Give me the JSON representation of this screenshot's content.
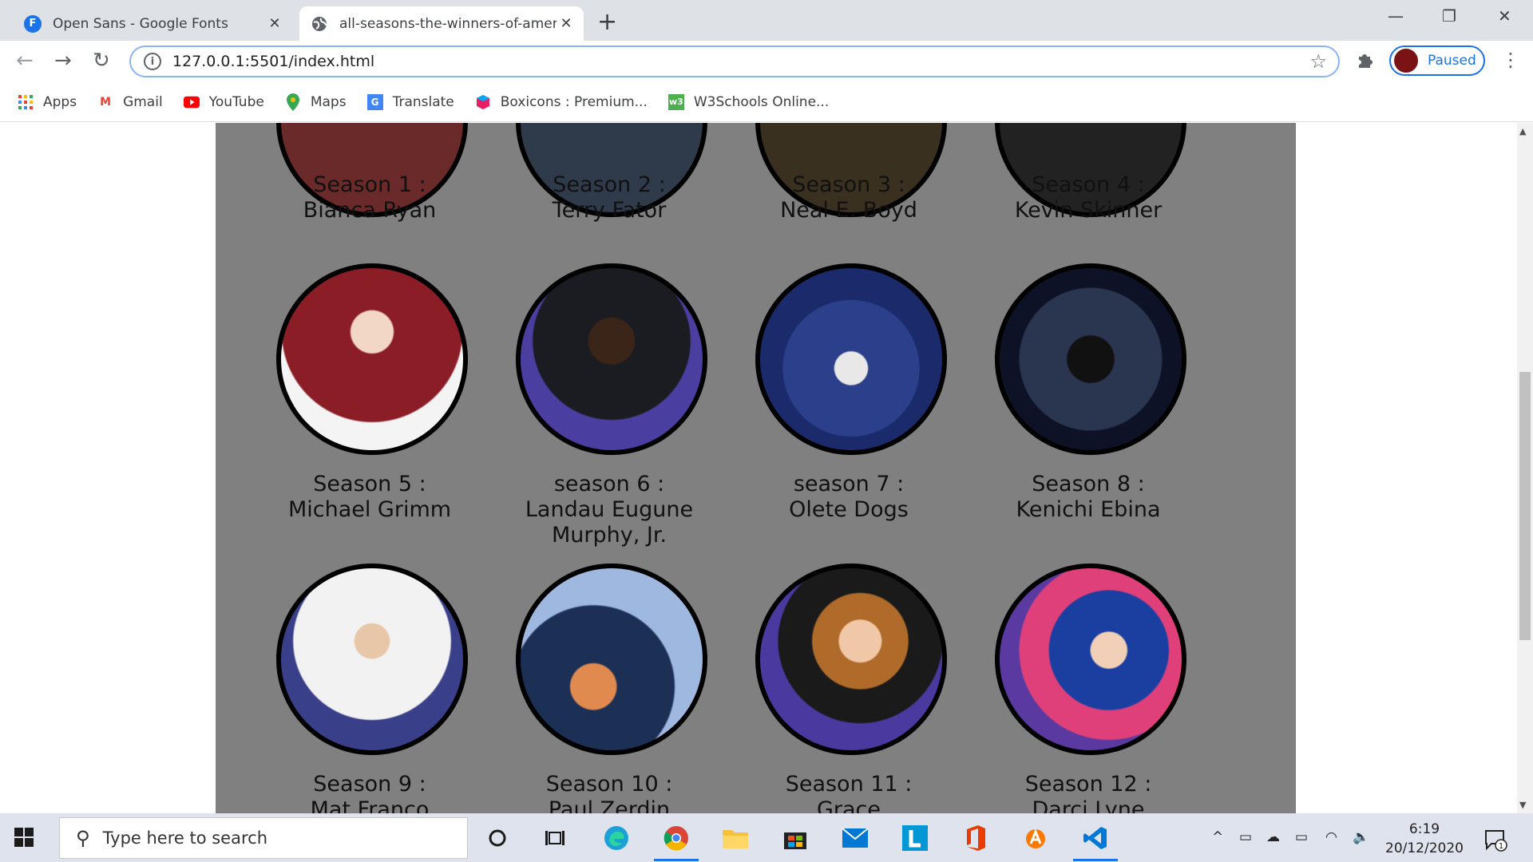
{
  "browser": {
    "tabs": [
      {
        "title": "Open Sans - Google Fonts",
        "favicon": "F",
        "close": "✕"
      },
      {
        "title": "all-seasons-the-winners-of-amer",
        "favicon": "globe-icon",
        "close": "✕"
      }
    ],
    "new_tab": "+",
    "window_controls": {
      "minimize": "—",
      "restore": "❐",
      "close": "✕"
    },
    "url": "127.0.0.1:5501/index.html",
    "info_icon": "i",
    "profile_label": "Paused",
    "bookmarks": [
      {
        "label": "Apps",
        "icon": "apps-icon"
      },
      {
        "label": "Gmail",
        "icon": "gmail-icon"
      },
      {
        "label": "YouTube",
        "icon": "youtube-icon"
      },
      {
        "label": "Maps",
        "icon": "maps-icon"
      },
      {
        "label": "Translate",
        "icon": "translate-icon"
      },
      {
        "label": "Boxicons : Premium...",
        "icon": "boxicons-icon"
      },
      {
        "label": "W3Schools Online...",
        "icon": "w3schools-icon"
      }
    ],
    "accent_color": "#1a73e8"
  },
  "page": {
    "background": "#808080",
    "winners": [
      {
        "season": "Season 1 :",
        "name": "Bianca Ryan"
      },
      {
        "season": "Season 2 :",
        "name": "Terry Fator"
      },
      {
        "season": "Season 3 :",
        "name": "Neal E. Boyd"
      },
      {
        "season": "Season 4 :",
        "name": "Kevin Skinner"
      },
      {
        "season": "Season 5 :",
        "name": "Michael Grimm"
      },
      {
        "season": "season 6 :",
        "name": "Landau Eugune",
        "name2": "Murphy, Jr."
      },
      {
        "season": "season 7 :",
        "name": "Olete Dogs"
      },
      {
        "season": "Season 8 :",
        "name": "Kenichi Ebina"
      },
      {
        "season": "Season 9 :",
        "name": "Mat Franco"
      },
      {
        "season": "Season 10 :",
        "name": "Paul Zerdin"
      },
      {
        "season": "Season 11 :",
        "name": "Grace"
      },
      {
        "season": "Season 12 :",
        "name": "Darci Lyne"
      }
    ]
  },
  "taskbar": {
    "search_placeholder": "Type here to search",
    "time": "6:19",
    "date": "20/12/2020",
    "notification_count": "1"
  }
}
